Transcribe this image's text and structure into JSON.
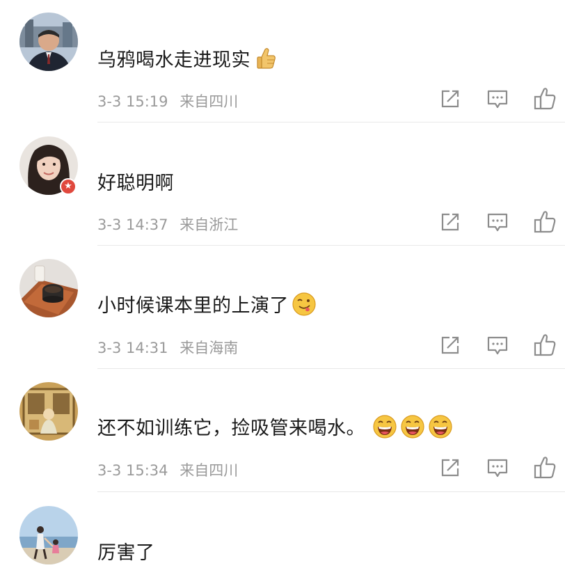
{
  "comments": [
    {
      "text": "乌鸦喝水走进现实",
      "date": "3-3",
      "time": "15:19",
      "source": "来自四川",
      "emojis": [
        "thumbs-up"
      ],
      "avatar": "man-in-suit",
      "badge": false
    },
    {
      "text": "好聪明啊",
      "date": "3-3",
      "time": "14:37",
      "source": "来自浙江",
      "emojis": [],
      "avatar": "woman-portrait",
      "badge": true
    },
    {
      "text": "小时候课本里的上演了",
      "date": "3-3",
      "time": "14:31",
      "source": "来自海南",
      "emojis": [
        "tongue-face"
      ],
      "avatar": "tea-cup",
      "badge": false
    },
    {
      "text": "还不如训练它，捡吸管来喝水。",
      "date": "3-3",
      "time": "15:34",
      "source": "来自四川",
      "emojis": [
        "laughing-face",
        "laughing-face",
        "laughing-face"
      ],
      "avatar": "painting",
      "badge": false
    },
    {
      "text": "厉害了",
      "avatar": "beach-family",
      "badge": false
    }
  ],
  "colors": {
    "text": "#1a1a1a",
    "meta": "#9a9a9a",
    "icon": "#8c8c8c",
    "divider": "#e8e8e8",
    "badge": "#e0483d"
  },
  "action_icons": [
    "share-icon",
    "comment-icon",
    "like-icon"
  ]
}
